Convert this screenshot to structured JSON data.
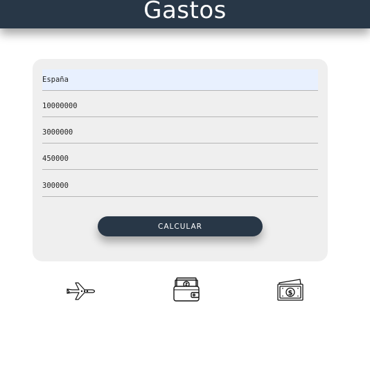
{
  "header": {
    "title": "Gastos"
  },
  "form": {
    "country": "España",
    "field_2": "10000000",
    "field_3": "3000000",
    "field_4": "450000",
    "field_5": "300000",
    "submit_label": "CALCULAR"
  },
  "icons": [
    "airplane-icon",
    "wallet-icon",
    "cash-icon"
  ],
  "colors": {
    "primary": "#283747",
    "card": "#efefef"
  }
}
